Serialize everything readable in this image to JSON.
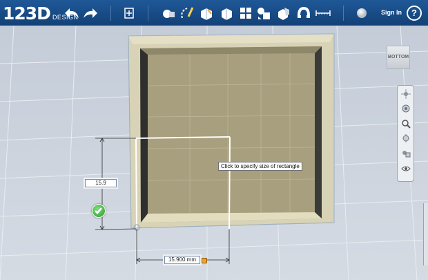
{
  "app": {
    "logo_main": "123D",
    "logo_sub": "DESIGN"
  },
  "toolbar": {
    "icons": [
      "undo-icon",
      "redo-icon",
      "transform-icon",
      "primitives-icon",
      "sketch-icon",
      "construct-icon",
      "modify-icon",
      "pattern-icon",
      "grouping-icon",
      "combine-icon",
      "snap-icon",
      "measure-icon",
      "material-icon"
    ],
    "signin_label": "Sign In",
    "help_label": "?"
  },
  "viewcube": {
    "label": "BOTTOM"
  },
  "navbar": {
    "icons": [
      "pan-icon",
      "orbit-icon",
      "zoom-icon",
      "fit-icon",
      "view-icon",
      "visibility-icon"
    ]
  },
  "sketch": {
    "height_value": "15.9",
    "width_value": "15.900 mm",
    "tooltip": "Click to specify size of rectangle"
  },
  "colors": {
    "toolbar": "#1a4e8a",
    "box_frame": "#d8d3b6",
    "box_inner": "#a89f7e",
    "sketch_line": "#ffffff"
  }
}
